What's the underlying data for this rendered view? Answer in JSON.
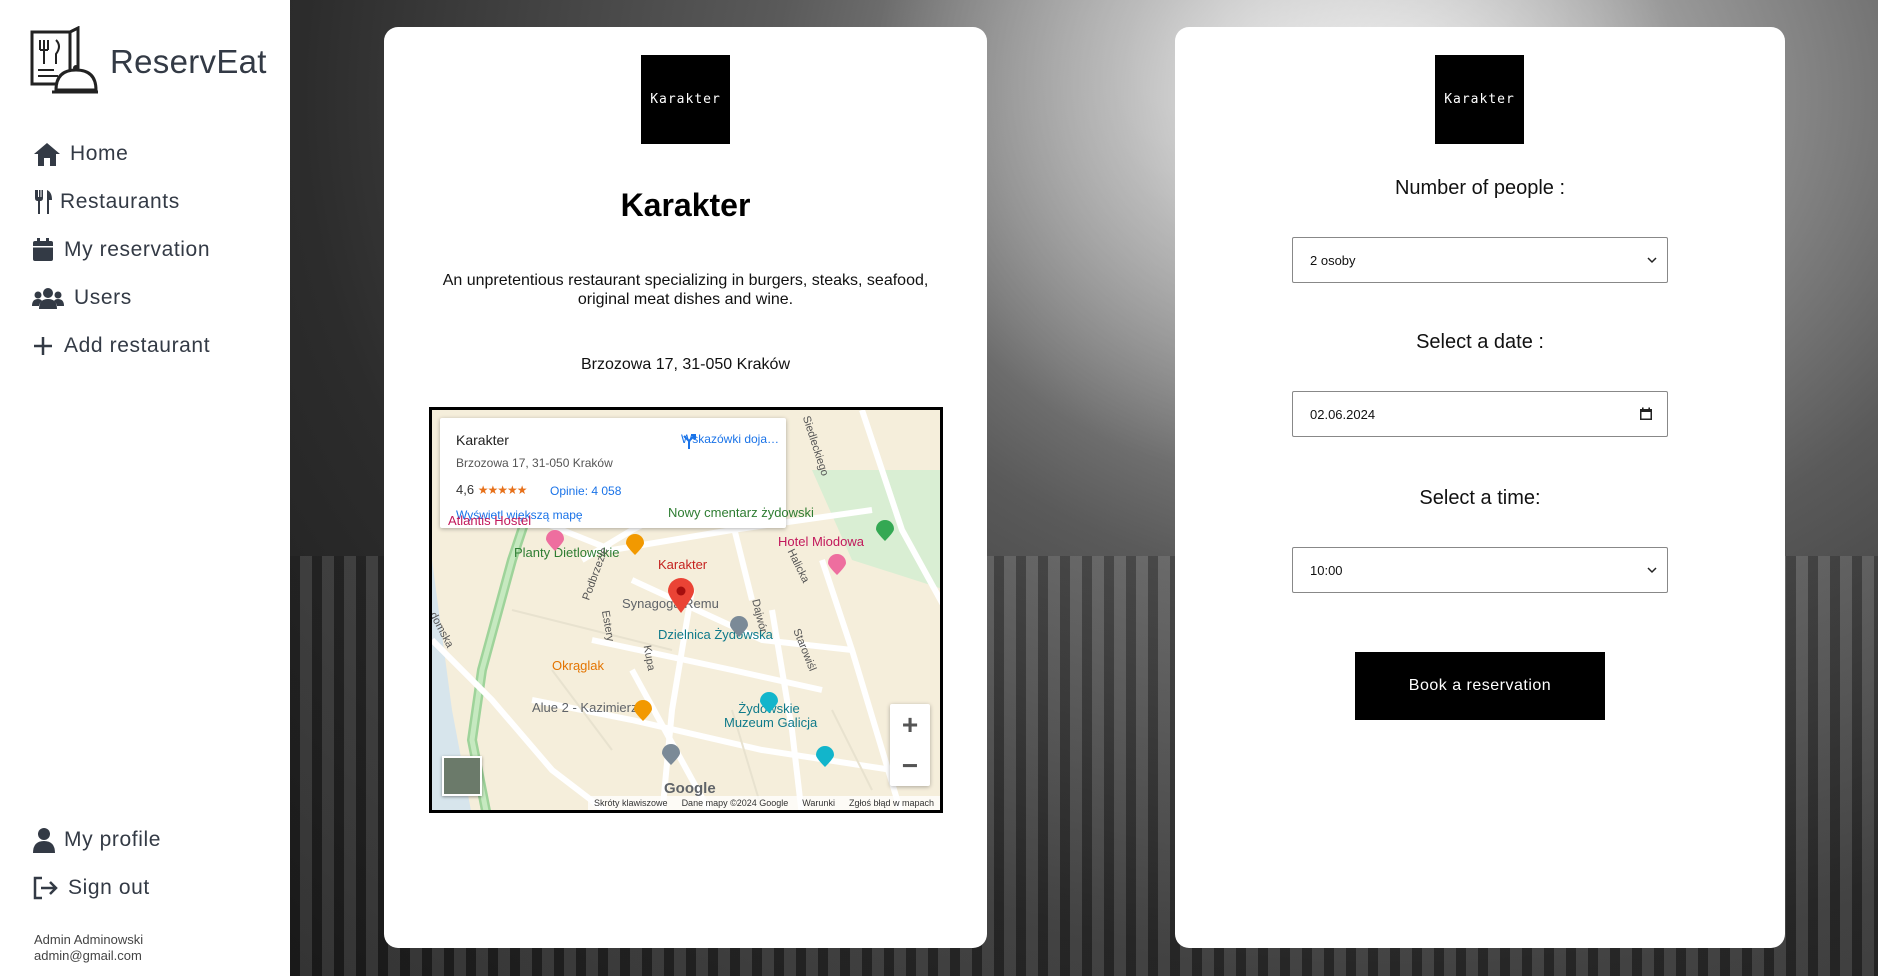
{
  "app": {
    "name": "ReservEat"
  },
  "sidebar": {
    "items": [
      {
        "label": "Home",
        "icon": "home-icon"
      },
      {
        "label": "Restaurants",
        "icon": "utensils-icon"
      },
      {
        "label": "My reservation",
        "icon": "calendar-icon"
      },
      {
        "label": "Users",
        "icon": "users-icon"
      },
      {
        "label": "Add restaurant",
        "icon": "plus-icon"
      }
    ],
    "bottom_items": [
      {
        "label": "My profile",
        "icon": "user-icon"
      },
      {
        "label": "Sign out",
        "icon": "sign-out-icon"
      }
    ],
    "user": {
      "name": "Admin Adminowski",
      "email": "admin@gmail.com"
    }
  },
  "restaurant": {
    "logo_text": "Karakter",
    "name": "Karakter",
    "description": "An unpretentious restaurant specializing in burgers, steaks, seafood, original meat dishes and wine.",
    "address": "Brzozowa 17, 31-050 Kraków"
  },
  "map": {
    "info_name": "Karakter",
    "info_address": "Brzozowa 17, 31-050 Kraków",
    "rating": "4,6",
    "stars": "★★★★★",
    "reviews": "Opinie: 4 058",
    "bigger_map": "Wyświetl większą mapę",
    "directions": "Wskazówki doja…",
    "labels": {
      "cemetery": "Nowy cmentarz żydowski",
      "hostel": "Atlantis Hostel",
      "hotel": "Hotel Miodowa",
      "planty": "Planty Dietlowskie",
      "karakter": "Karakter",
      "synagogue": "Synagoga Remu",
      "district": "Dzielnica Żydowska",
      "okraglak": "Okrąglak",
      "alue": "Alue 2 - Kazimierz",
      "museum1": "Żydowskie",
      "museum2": "Muzeum Galicja",
      "siedleckiego": "Siedleckiego",
      "halicka": "Halicka",
      "podbrzezie": "Podbrzezie",
      "estery": "Estery",
      "kupa": "Kupa",
      "dajwor": "Dajwór",
      "starowislna": "Starowiśl",
      "radomska": "domska"
    },
    "google": "Google",
    "footer": [
      "Skróty klawiszowe",
      "Dane mapy ©2024 Google",
      "Warunki",
      "Zgłoś błąd w mapach"
    ],
    "zoom_in": "+",
    "zoom_out": "−"
  },
  "booking": {
    "logo_text": "Karakter",
    "people_label": "Number of people :",
    "people_value": "2 osoby",
    "date_label": "Select a date :",
    "date_value": "02.06.2024",
    "time_label": "Select a time:",
    "time_value": "10:00",
    "button_label": "Book a reservation"
  }
}
